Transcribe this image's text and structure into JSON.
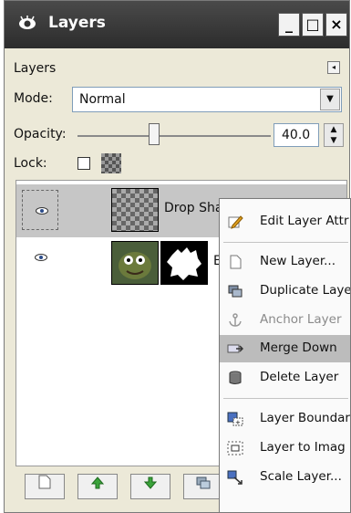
{
  "window": {
    "title": "Layers",
    "buttons": {
      "minimize": "_",
      "maximize": "□",
      "close": "×"
    }
  },
  "panel": {
    "tab_label": "Layers",
    "mode_label": "Mode:",
    "mode_value": "Normal",
    "opacity_label": "Opacity:",
    "opacity_value": "40.0",
    "opacity_percent": 40,
    "lock_label": "Lock:"
  },
  "layers": [
    {
      "name": "Drop Sha",
      "visible": true,
      "selected": true
    },
    {
      "name": "E",
      "visible": true,
      "selected": false
    }
  ],
  "context_menu": {
    "items": [
      {
        "label": "Edit Layer Attr",
        "icon": "edit-pencil-icon",
        "enabled": true
      },
      {
        "label": "New Layer...",
        "icon": "new-page-icon",
        "enabled": true
      },
      {
        "label": "Duplicate Laye",
        "icon": "duplicate-icon",
        "enabled": true
      },
      {
        "label": "Anchor Layer",
        "icon": "anchor-icon",
        "enabled": false
      },
      {
        "label": "Merge Down",
        "icon": "merge-down-icon",
        "enabled": true,
        "highlighted": true
      },
      {
        "label": "Delete Layer",
        "icon": "trash-icon",
        "enabled": true
      },
      {
        "label": "Layer Boundar",
        "icon": "layer-boundary-icon",
        "enabled": true
      },
      {
        "label": "Layer to Imag",
        "icon": "layer-to-image-icon",
        "enabled": true
      },
      {
        "label": "Scale Layer...",
        "icon": "scale-icon",
        "enabled": true
      }
    ]
  },
  "colors": {
    "titlebar": "#3a3a3a",
    "menu_highlight": "#bcbcbc",
    "selected_row": "#c6c6c6"
  }
}
